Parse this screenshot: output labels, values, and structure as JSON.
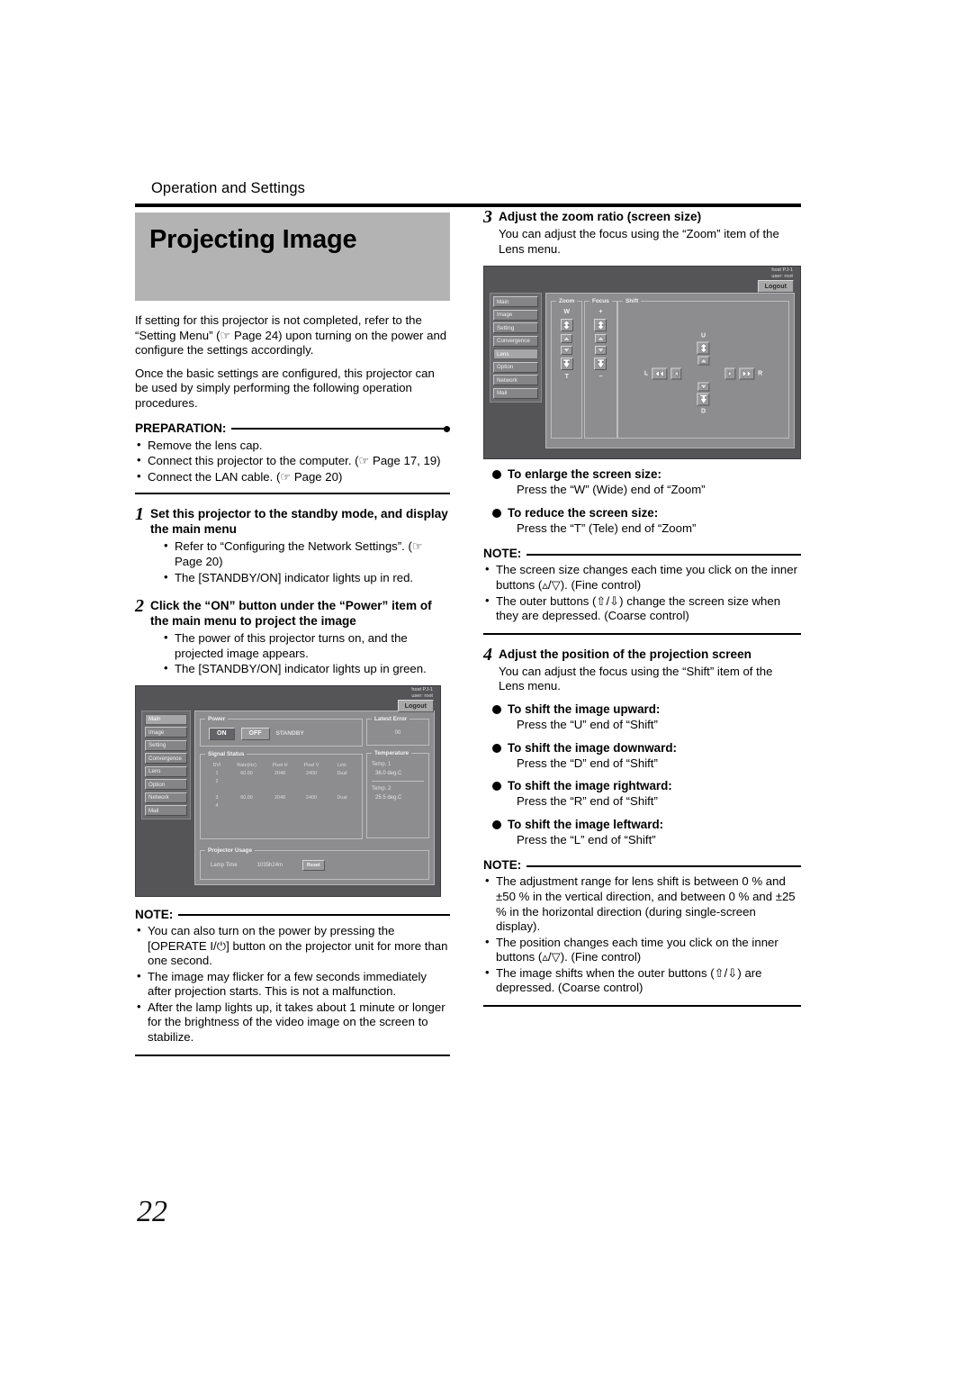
{
  "page": {
    "running_head": "Operation and Settings",
    "page_number": "22",
    "title": "Projecting Image"
  },
  "left": {
    "intro": [
      "If setting for this projector is not completed, refer to the “Setting Menu” (☞ Page 24) upon turning on the power and configure the settings accordingly.",
      "Once the basic settings are configured, this projector can be used by simply performing the following operation procedures."
    ],
    "preparation": {
      "heading": "PREPARATION:",
      "items": [
        "Remove the lens cap.",
        "Connect this projector to the computer. (☞ Page 17, 19)",
        "Connect the LAN cable. (☞ Page 20)"
      ]
    },
    "step1": {
      "number": "1",
      "title": "Set this projector to the standby mode, and display the main menu",
      "bullets": [
        "Refer to “Configuring the Network Settings”. (☞ Page 20)",
        "The [STANDBY/ON] indicator lights up in red."
      ]
    },
    "step2": {
      "number": "2",
      "title": "Click the “ON” button under the “Power” item of the main menu to project the image",
      "bullets": [
        "The power of this projector turns on, and the projected image appears.",
        "The [STANDBY/ON] indicator lights up in green."
      ]
    },
    "note": {
      "heading": "NOTE:",
      "items": [
        "You can also turn on the power by pressing the [OPERATE I/⏻] button on the projector unit for more than one second.",
        "The image may flicker for a few seconds immediately after projection starts. This is not a malfunction.",
        "After the lamp lights up, it takes about 1 minute or longer for the brightness of the video image on the screen to stabilize."
      ]
    }
  },
  "right": {
    "step3": {
      "number": "3",
      "title": "Adjust the zoom ratio (screen size)",
      "sub": "You can adjust the focus using the “Zoom” item of the Lens menu."
    },
    "enlarge": {
      "heading": "To enlarge the screen size:",
      "sub": "Press the “W” (Wide) end of “Zoom”"
    },
    "reduce": {
      "heading": "To reduce the screen size:",
      "sub": "Press the “T” (Tele) end of “Zoom”"
    },
    "note_zoom": {
      "heading": "NOTE:",
      "items": [
        "The screen size changes each time you click on the inner buttons (▵/▽). (Fine control)",
        "The outer buttons (⇧/⇩) change the screen size when they are depressed. (Coarse control)"
      ]
    },
    "step4": {
      "number": "4",
      "title": "Adjust the position of the projection screen",
      "sub": "You can adjust the focus using the “Shift” item of the Lens menu."
    },
    "shift_up": {
      "heading": "To shift the image upward:",
      "sub": "Press the “U” end of “Shift”"
    },
    "shift_down": {
      "heading": "To shift the image downward:",
      "sub": "Press the “D” end of “Shift”"
    },
    "shift_right": {
      "heading": "To shift the image rightward:",
      "sub": "Press the “R” end of “Shift”"
    },
    "shift_left": {
      "heading": "To shift the image leftward:",
      "sub": "Press the “L” end of “Shift”"
    },
    "note_shift": {
      "heading": "NOTE:",
      "items": [
        "The adjustment range for lens shift is between 0 % and ±50 % in the vertical direction, and between 0 % and ±25 % in the horizontal direction (during single-screen display).",
        "The position changes each time you click on the inner buttons (▵/▽). (Fine control)",
        "The image shifts when the outer buttons (⇧/⇩) are depressed. (Coarse control)"
      ]
    }
  },
  "main_shot": {
    "host": "host PJ-1",
    "user": "user: root",
    "logout": "Logout",
    "nav": [
      "Main",
      "Image",
      "Setting",
      "Convergence",
      "Lens",
      "Option",
      "Network",
      "Mail"
    ],
    "nav_selected": "Main",
    "power": {
      "legend": "Power",
      "on": "ON",
      "off": "OFF",
      "status": "STANDBY"
    },
    "signal_status": {
      "legend": "Signal Status",
      "headers": [
        "DVI",
        "Rate(Hz)",
        "Pixel H",
        "Pixel V",
        "Link"
      ],
      "rows": [
        [
          "1",
          "60.00",
          "2048",
          "2400",
          "Dual"
        ],
        [
          "2",
          "",
          "",
          "",
          ""
        ],
        [
          "3",
          "60.00",
          "2048",
          "2400",
          "Dual"
        ],
        [
          "4",
          "",
          "",
          "",
          ""
        ]
      ]
    },
    "latest_error": {
      "legend": "Latest Error",
      "value": "00"
    },
    "temperature": {
      "legend": "Temperature",
      "items": [
        {
          "label": "Temp. 1",
          "value": "36.0 deg.C"
        },
        {
          "label": "Temp. 2",
          "value": "25.5 deg.C"
        }
      ]
    },
    "projector_usage": {
      "legend": "Projector Usage",
      "label": "Lamp Time",
      "value": "1035h24m",
      "reset": "Reset"
    }
  },
  "lens_shot": {
    "host": "host PJ-1",
    "user": "user: root",
    "logout": "Logout",
    "nav": [
      "Main",
      "Image",
      "Setting",
      "Convergence",
      "Lens",
      "Option",
      "Network",
      "Mail"
    ],
    "nav_selected": "Lens",
    "zoom": {
      "legend": "Zoom",
      "top_label": "W",
      "bottom_label": "T"
    },
    "focus": {
      "legend": "Focus",
      "top_label": "+",
      "bottom_label": "−"
    },
    "shift": {
      "legend": "Shift",
      "up": "U",
      "down": "D",
      "left": "L",
      "right": "R"
    }
  }
}
